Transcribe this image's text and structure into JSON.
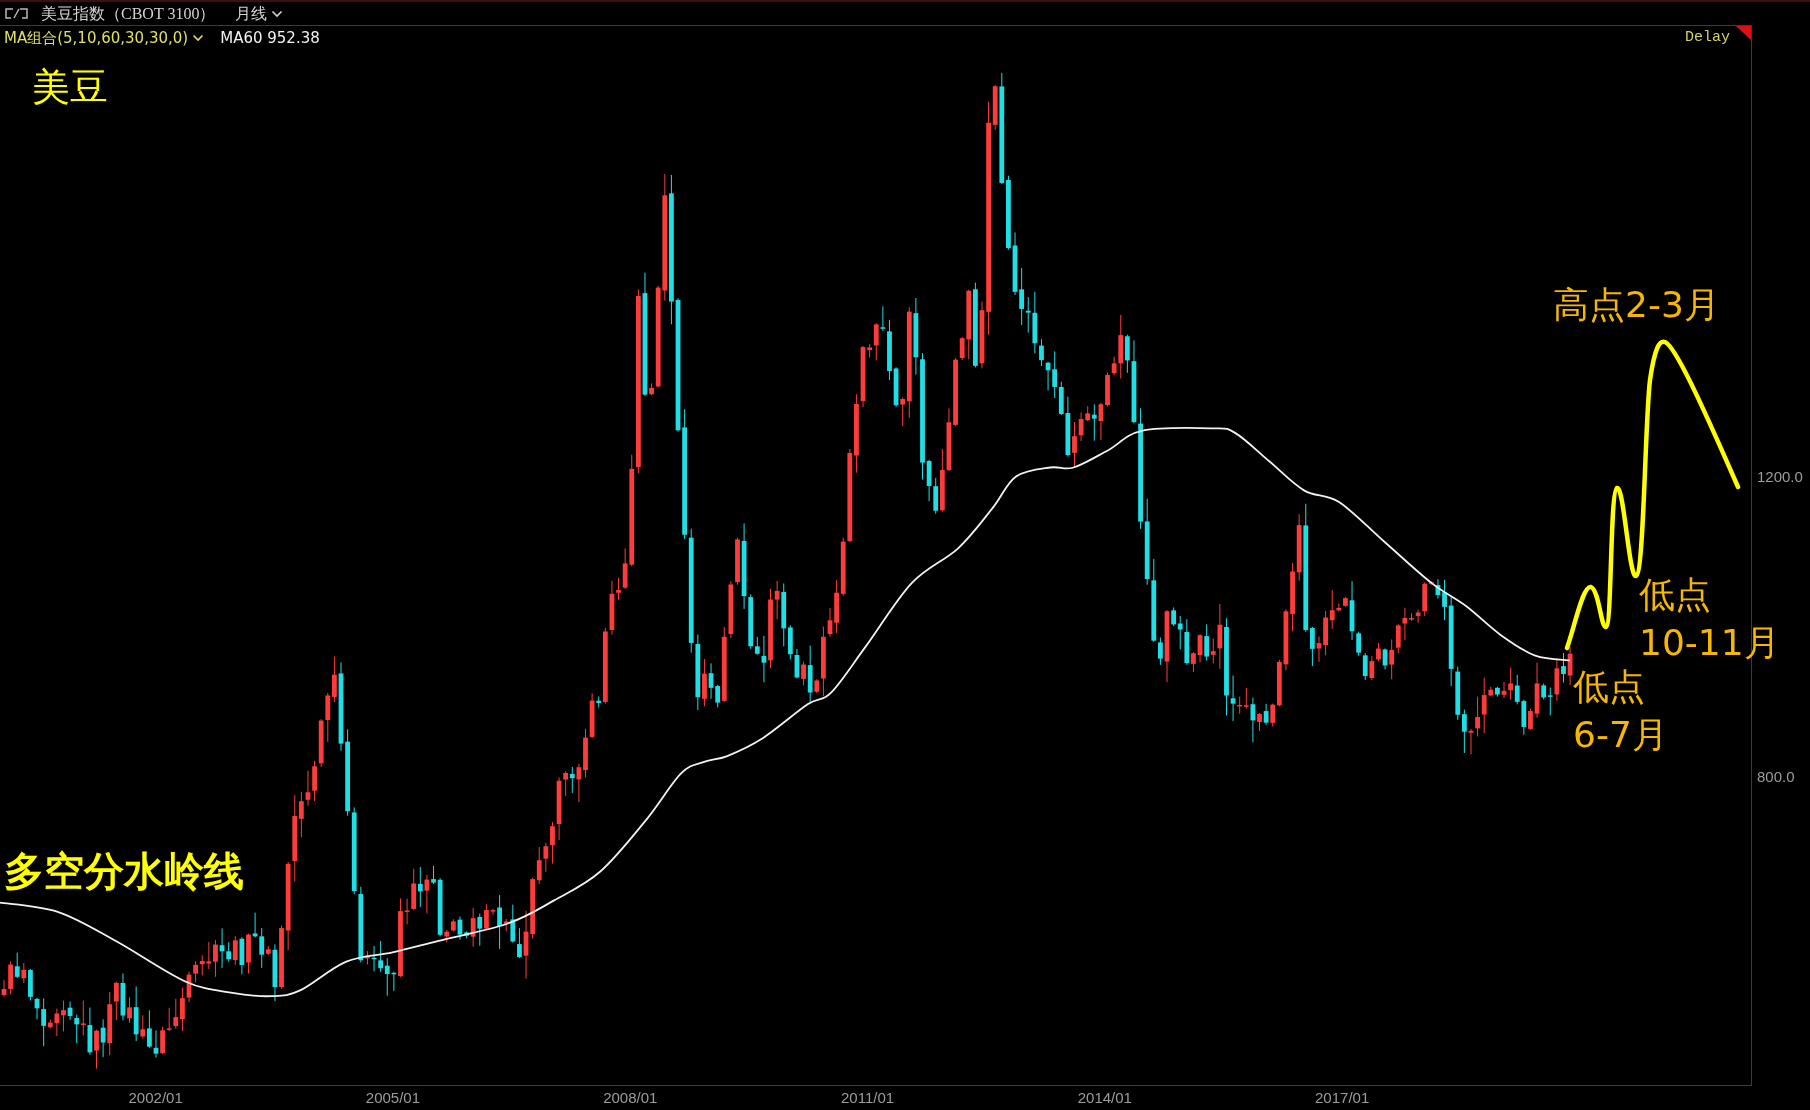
{
  "header": {
    "title": "美豆指数（CBOT 3100）",
    "period": "月线"
  },
  "legend": {
    "indicator": "MA组合(5,10,60,30,30,0)",
    "ma_reading": "MA60 952.38"
  },
  "feed_status": "Delay",
  "annotations": {
    "asset": "美豆",
    "forecast_high": "高点2-3月",
    "forecast_low_late": [
      "低点",
      "10-11月"
    ],
    "forecast_low_near": [
      "低点",
      "6-7月"
    ],
    "ma_line": "多空分水岭线"
  },
  "y_axis_labels": [
    "1200.0",
    "800.0"
  ],
  "x_axis_labels": [
    "2002/01",
    "2005/01",
    "2008/01",
    "2011/01",
    "2014/01",
    "2017/01"
  ]
}
